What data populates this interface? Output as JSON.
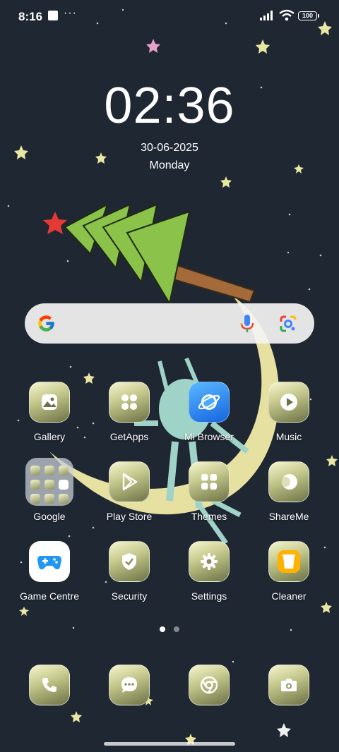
{
  "status_bar": {
    "time": "8:16",
    "notification_dots": "···",
    "battery_level": "100"
  },
  "lock_widget": {
    "time": "02:36",
    "date": "30-06-2025",
    "day": "Monday"
  },
  "search_bar": {
    "icons": [
      "google-logo-icon",
      "microphone-icon",
      "google-lens-icon"
    ]
  },
  "apps": {
    "gallery": "Gallery",
    "getapps": "GetApps",
    "mi_browser": "Mi Browser",
    "music": "Music",
    "google": "Google",
    "play_store": "Play Store",
    "themes": "Themes",
    "shareme": "ShareMe",
    "game_centre": "Game Centre",
    "security": "Security",
    "settings": "Settings",
    "cleaner": "Cleaner"
  },
  "page_indicator": {
    "pages": 2,
    "current": 1
  },
  "dock": {
    "icons": [
      "phone-icon",
      "messages-icon",
      "chrome-icon",
      "camera-icon"
    ]
  },
  "colors": {
    "background": "#1f2733",
    "icon_gradient_light": "#f6f6cf",
    "icon_gradient_dark": "#6c7245",
    "tree_green": "#8bc34a",
    "moon_yellow": "#f2eba8",
    "alien_teal": "#9fd3c7",
    "star_red": "#e53935"
  }
}
